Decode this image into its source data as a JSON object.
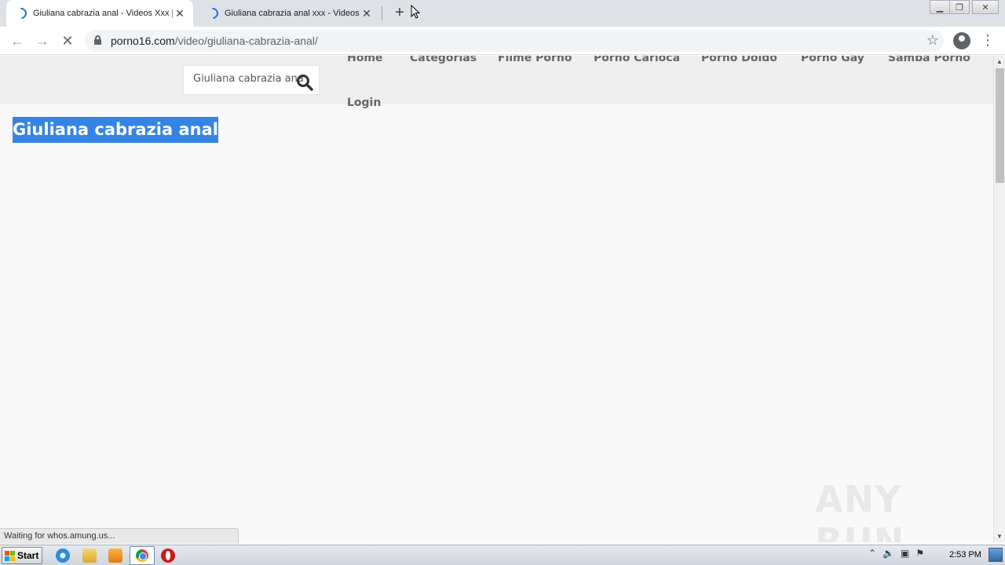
{
  "browser": {
    "tabs": [
      {
        "title": "Giuliana cabrazia anal - Videos Xxx |",
        "active": true
      },
      {
        "title": "Giuliana cabrazia anal xxx - Videos X",
        "active": false
      }
    ],
    "new_tab_label": "+",
    "url_host": "porno16.com",
    "url_path": "/video/giuliana-cabrazia-anal/",
    "status_text": "Waiting for whos.amung.us..."
  },
  "site": {
    "search": {
      "value": "Giuliana cabrazia anal",
      "placeholder": ""
    },
    "nav": [
      "Home",
      "Categorias",
      "Filme Porno",
      "Porno Carioca",
      "Porno Doido",
      "Porno Gay",
      "Samba Porno",
      "Login"
    ],
    "page_title": "Giuliana cabrazia anal",
    "watermark": "ANY RUN"
  },
  "taskbar": {
    "start_label": "Start",
    "clock": "2:53 PM"
  },
  "colors": {
    "selection": "#3584e4",
    "header_bg": "#eeeeee",
    "page_bg": "#f9f9f9"
  }
}
